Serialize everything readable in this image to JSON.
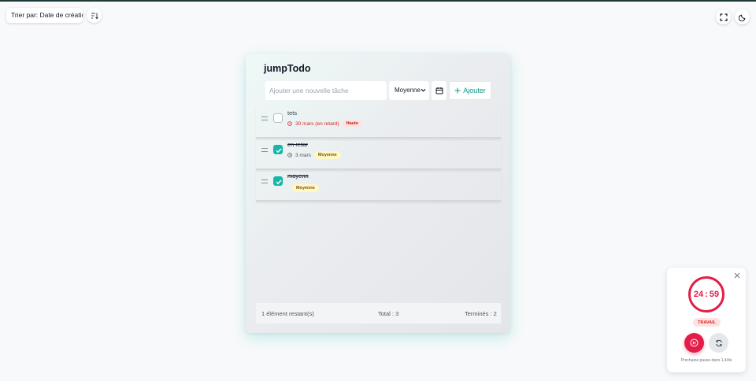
{
  "sort": {
    "label": "Trier par: Date de création ."
  },
  "card": {
    "title": "jumpTodo",
    "input_placeholder": "Ajouter une nouvelle tâche",
    "priority_selected": "Moyenne",
    "add_label": "Ajouter"
  },
  "tasks": [
    {
      "title": "tets",
      "completed": false,
      "due": "30 mars (en retard)",
      "overdue": true,
      "priority": "Haute"
    },
    {
      "title": "en retar",
      "completed": true,
      "due": "3 mars",
      "overdue": false,
      "priority": "Moyenne"
    },
    {
      "title": "moyenn",
      "completed": true,
      "due": "",
      "overdue": false,
      "priority": "Moyenne"
    }
  ],
  "footer": {
    "remaining": "1 élément restant(s)",
    "total": "Total : 3",
    "done": "Terminés : 2"
  },
  "pomodoro": {
    "minutes": "24",
    "seconds": "59",
    "mode": "TRAVAIL",
    "next_break": "Prochaine pause dans 1,4/4s"
  },
  "colors": {
    "accent": "#14b8a6",
    "pomodoro": "#e11d48",
    "high_priority": "#fde2e2",
    "medium_priority": "#fef9c3"
  },
  "icons": {
    "sort_direction": "sort-direction-icon",
    "fullscreen": "fullscreen-icon",
    "theme": "moon-icon",
    "calendar": "calendar-icon",
    "add": "plus-icon",
    "drag": "drag-handle-icon",
    "clock": "clock-icon",
    "close": "close-icon",
    "pause": "pause-icon",
    "reset": "reset-icon"
  }
}
